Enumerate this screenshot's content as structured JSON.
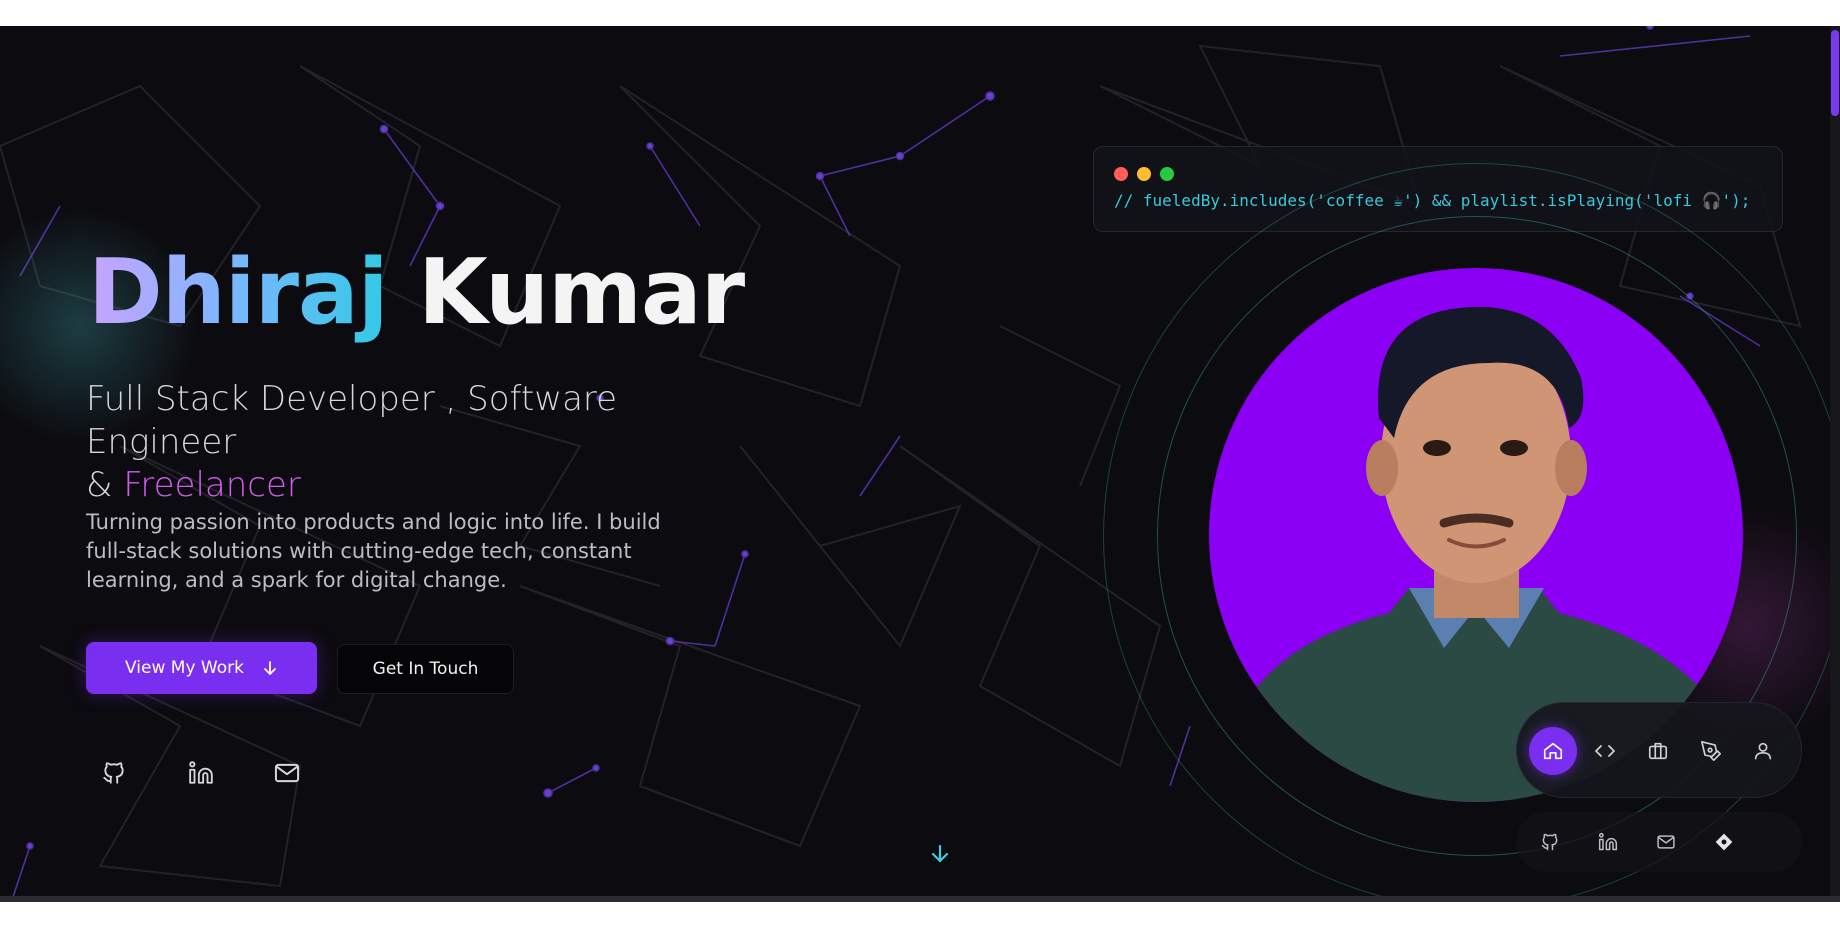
{
  "hero": {
    "first_name": "Dhiraj",
    "last_name": "Kumar",
    "subtitle_line1": "Full Stack Developer , Software Engineer",
    "subtitle_amp": "& ",
    "subtitle_highlight": "Freelancer",
    "description": "Turning passion into products and logic into life. I build full-stack solutions with cutting-edge tech, constant learning, and a spark for digital change."
  },
  "buttons": {
    "primary_label": "View My Work",
    "primary_icon": "arrow-down-icon",
    "secondary_label": "Get In Touch"
  },
  "socials": [
    {
      "name": "github-icon"
    },
    {
      "name": "linkedin-icon"
    },
    {
      "name": "mail-icon"
    }
  ],
  "code_window": {
    "line": "// fueledBy.includes('coffee ☕') && playlist.isPlaying('lofi 🎧');",
    "dots": [
      "#ff5f57",
      "#febc2e",
      "#28c840"
    ]
  },
  "nav": {
    "items": [
      {
        "name": "home-icon",
        "active": true
      },
      {
        "name": "code-icon",
        "active": false
      },
      {
        "name": "briefcase-icon",
        "active": false
      },
      {
        "name": "pen-tool-icon",
        "active": false
      },
      {
        "name": "user-icon",
        "active": false
      }
    ]
  },
  "mini_bar": {
    "items": [
      {
        "name": "github-icon"
      },
      {
        "name": "linkedin-icon"
      },
      {
        "name": "mail-icon"
      },
      {
        "name": "diamond-icon"
      }
    ]
  },
  "colors": {
    "background": "#0c0b0f",
    "accent_purple": "#7a2ff0",
    "photo_bg": "#8b00f5",
    "code_cyan": "#38c9dc",
    "highlight_pink": "#d45cf0"
  }
}
